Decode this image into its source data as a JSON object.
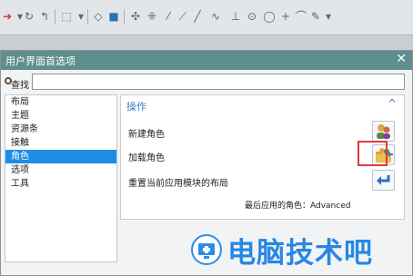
{
  "dialog": {
    "title": "用户界面首选项",
    "search_label": "查找",
    "search_value": ""
  },
  "left_list": [
    "布局",
    "主题",
    "资源条",
    "接触",
    "角色",
    "选项",
    "工具"
  ],
  "panel": {
    "section_title": "操作",
    "actions": [
      "新建角色",
      "加载角色",
      "重置当前应用模块的布局"
    ],
    "recent_role": "最后应用的角色：Advanced"
  },
  "watermark": "电脑技术吧",
  "colors": {
    "title_bar": "#5e8f8e",
    "selection": "#1e8de6",
    "accent": "#3a7fc8",
    "highlight": "#e33a3a"
  }
}
